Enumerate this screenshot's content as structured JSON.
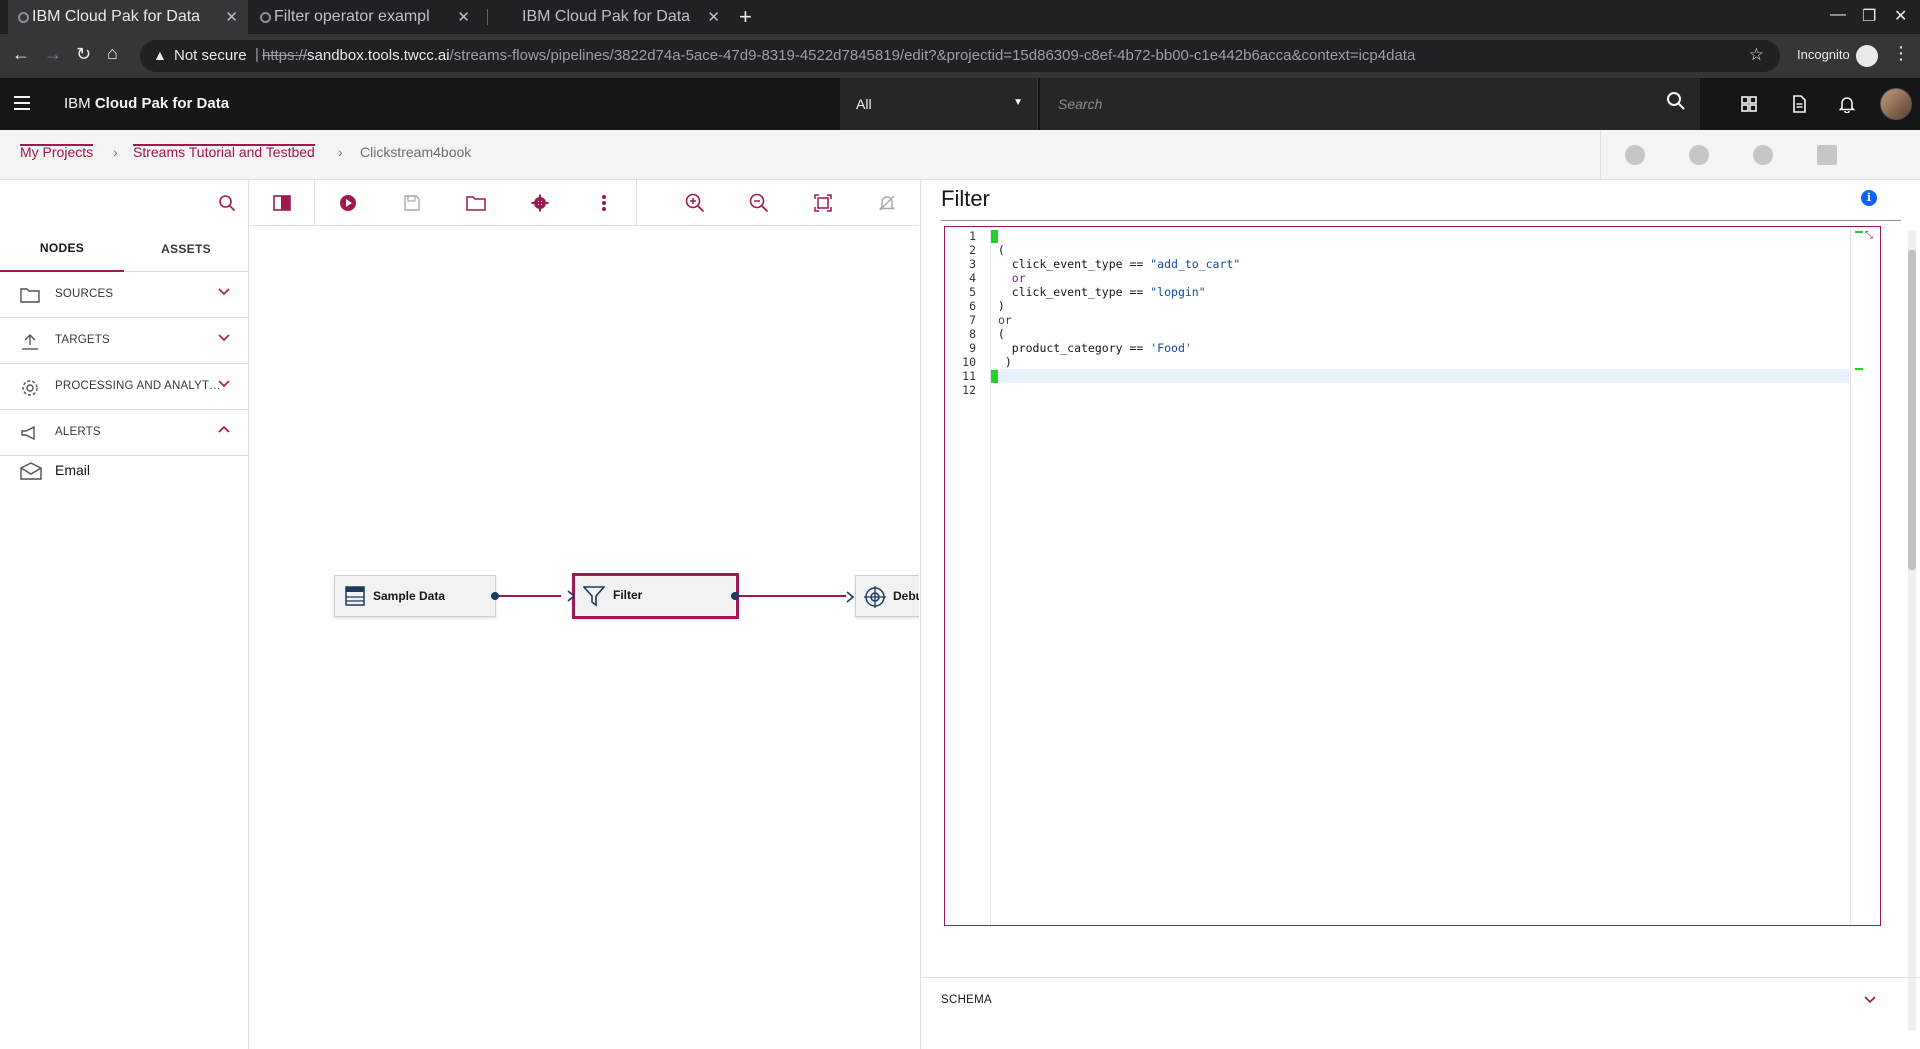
{
  "browser": {
    "tabs": [
      {
        "title": "IBM Cloud Pak for Data",
        "active": true
      },
      {
        "title": "Filter operator exampl",
        "active": false
      },
      {
        "title": "IBM Cloud Pak for Data",
        "active": false
      }
    ],
    "security_label": "Not secure",
    "url_proto": "https://",
    "url_host": "sandbox.tools.twcc.ai",
    "url_path": "/streams-flows/pipelines/3822d74a-5ace-47d9-8319-4522d7845819/edit?&projectid=15d86309-c8ef-4b72-bb00-c1e442b6acca&context=icp4data",
    "profile_label": "Incognito"
  },
  "header": {
    "brand_plain": "IBM ",
    "brand_bold": "Cloud Pak for Data",
    "scope_value": "All",
    "search_placeholder": "Search"
  },
  "breadcrumb": {
    "items": [
      {
        "label": "My Projects"
      },
      {
        "label": "Streams Tutorial and Testbed"
      },
      {
        "label": "Clickstream4book"
      }
    ]
  },
  "palette": {
    "tabs": [
      "NODES",
      "ASSETS"
    ],
    "sections": [
      {
        "label": "SOURCES",
        "icon": "folder-icon",
        "expanded": false
      },
      {
        "label": "TARGETS",
        "icon": "upload-icon",
        "expanded": false
      },
      {
        "label": "PROCESSING AND ANALYT…",
        "icon": "gear-icon",
        "expanded": false
      },
      {
        "label": "ALERTS",
        "icon": "megaphone-icon",
        "expanded": true
      }
    ],
    "alert_items": [
      {
        "label": "Email",
        "icon": "email-icon"
      }
    ]
  },
  "canvas": {
    "nodes": [
      {
        "label": "Sample Data",
        "icon": "data-table-icon"
      },
      {
        "label": "Filter",
        "icon": "filter-icon",
        "selected": true
      },
      {
        "label": "Debu",
        "icon": "debug-target-icon"
      }
    ]
  },
  "properties": {
    "title": "Filter",
    "code_lines": [
      {
        "num": "1",
        "html": "<span class=\"bkt\"></span>"
      },
      {
        "num": "2",
        "html": " ("
      },
      {
        "num": "3",
        "html": "   click_event_type == <span class=\"str\">\"add_to_cart\"</span>"
      },
      {
        "num": "4",
        "html": "   <span class=\"kw\">or</span>"
      },
      {
        "num": "5",
        "html": "   click_event_type == <span class=\"str\">\"lopgin\"</span>"
      },
      {
        "num": "6",
        "html": " )"
      },
      {
        "num": "7",
        "html": " <span class=\"kw\">or</span>"
      },
      {
        "num": "8",
        "html": " ("
      },
      {
        "num": "9",
        "html": "   product_category == <span class=\"str\">'Food'</span>"
      },
      {
        "num": "10",
        "html": "  )"
      },
      {
        "num": "11",
        "html": "<span class=\"bkt\"></span>",
        "current": true
      },
      {
        "num": "12",
        "html": ""
      }
    ],
    "schema_label": "SCHEMA"
  },
  "colors": {
    "accent": "#9f1853",
    "header_bg": "#161616",
    "bracket_match": "#25d02a",
    "info": "#0f62fe"
  }
}
